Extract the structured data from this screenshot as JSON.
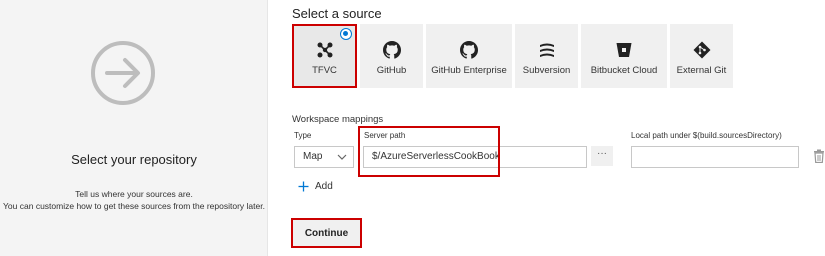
{
  "left": {
    "title": "Select your repository",
    "desc_line1": "Tell us where your sources are.",
    "desc_line2": "You can customize how to get these sources from the repository later."
  },
  "source": {
    "title": "Select a source",
    "items": [
      {
        "label": "TFVC",
        "icon": "tfvc-icon",
        "selected": true
      },
      {
        "label": "GitHub",
        "icon": "github-icon"
      },
      {
        "label": "GitHub Enterprise",
        "icon": "github-enterprise-icon"
      },
      {
        "label": "Subversion",
        "icon": "subversion-icon"
      },
      {
        "label": "Bitbucket Cloud",
        "icon": "bitbucket-icon"
      },
      {
        "label": "External Git",
        "icon": "git-icon"
      }
    ]
  },
  "mappings": {
    "title": "Workspace mappings",
    "type_label": "Type",
    "type_value": "Map",
    "server_label": "Server path",
    "server_value": "$/AzureServerlessCookBook",
    "local_label": "Local path under $(build.sourcesDirectory)",
    "local_value": "",
    "more_label": "···",
    "add_label": "Add"
  },
  "actions": {
    "continue_label": "Continue"
  },
  "colors": {
    "accent": "#0078d4",
    "highlight": "#cc0000"
  }
}
